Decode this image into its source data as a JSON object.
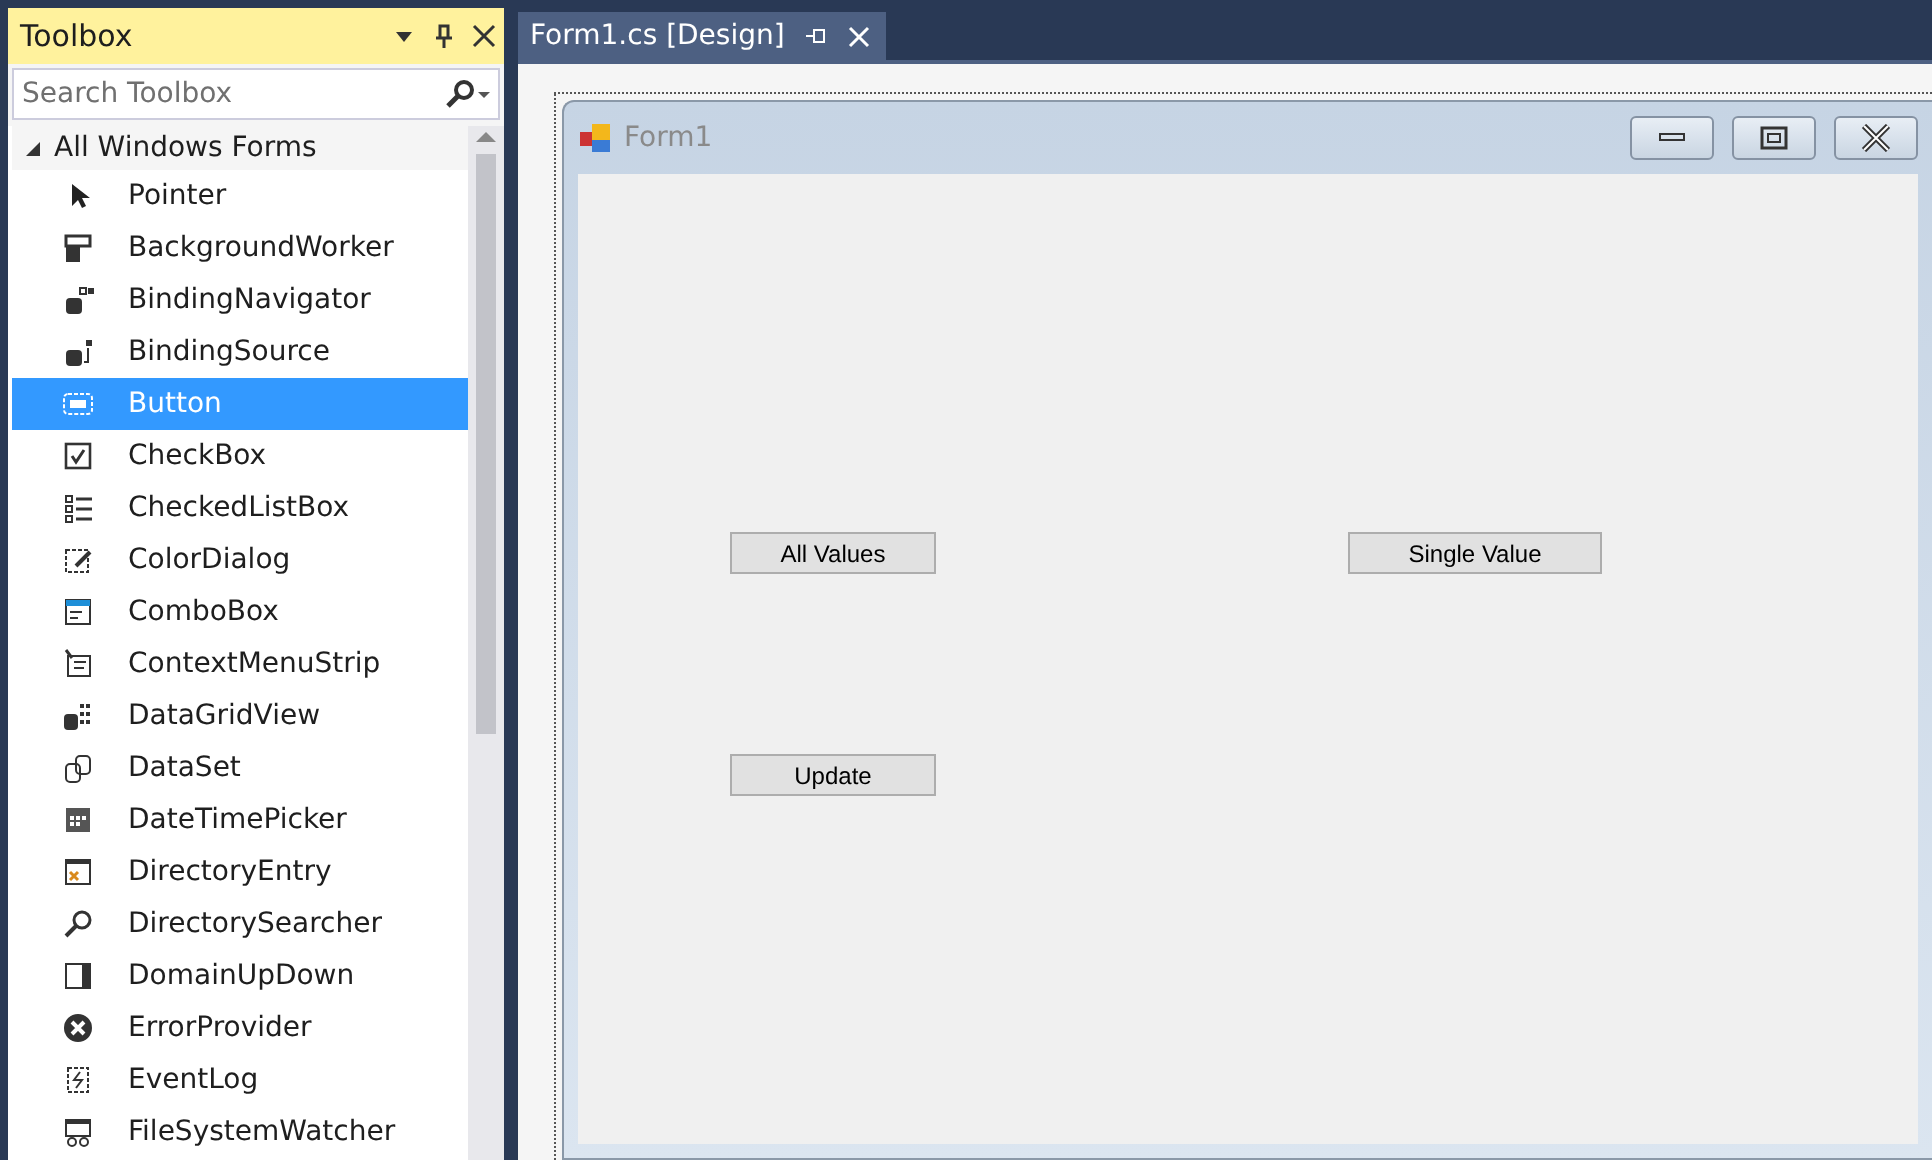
{
  "toolbox": {
    "title": "Toolbox",
    "search": {
      "placeholder": "Search Toolbox"
    },
    "group": {
      "label": "All Windows Forms",
      "expanded": true,
      "items": [
        {
          "label": "Pointer",
          "selected": false
        },
        {
          "label": "BackgroundWorker",
          "selected": false
        },
        {
          "label": "BindingNavigator",
          "selected": false
        },
        {
          "label": "BindingSource",
          "selected": false
        },
        {
          "label": "Button",
          "selected": true
        },
        {
          "label": "CheckBox",
          "selected": false
        },
        {
          "label": "CheckedListBox",
          "selected": false
        },
        {
          "label": "ColorDialog",
          "selected": false
        },
        {
          "label": "ComboBox",
          "selected": false
        },
        {
          "label": "ContextMenuStrip",
          "selected": false
        },
        {
          "label": "DataGridView",
          "selected": false
        },
        {
          "label": "DataSet",
          "selected": false
        },
        {
          "label": "DateTimePicker",
          "selected": false
        },
        {
          "label": "DirectoryEntry",
          "selected": false
        },
        {
          "label": "DirectorySearcher",
          "selected": false
        },
        {
          "label": "DomainUpDown",
          "selected": false
        },
        {
          "label": "ErrorProvider",
          "selected": false
        },
        {
          "label": "EventLog",
          "selected": false
        },
        {
          "label": "FileSystemWatcher",
          "selected": false
        }
      ]
    }
  },
  "document_tab": {
    "label": "Form1.cs [Design]",
    "selected": true
  },
  "form": {
    "title": "Form1",
    "buttons": [
      {
        "label": "All Values"
      },
      {
        "label": "Single Value"
      },
      {
        "label": "Update"
      }
    ]
  }
}
